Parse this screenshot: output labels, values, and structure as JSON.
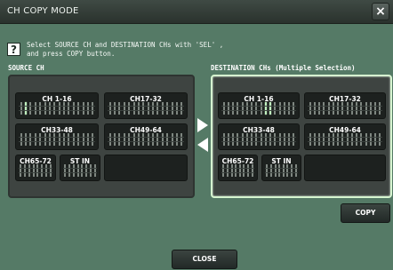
{
  "window": {
    "title": "CH COPY MODE",
    "close_glyph": "×"
  },
  "help": {
    "glyph": "?"
  },
  "instruction": {
    "line1": "Select SOURCE CH and DESTINATION CHs with 'SEL' ,",
    "line2": "and press COPY button."
  },
  "source": {
    "label": "SOURCE CH",
    "banks": [
      "CH 1-16",
      "CH17-32",
      "CH33-48",
      "CH49-64",
      "CH65-72",
      "ST IN"
    ]
  },
  "destination": {
    "label": "DESTINATION CHs (Multiple Selection)",
    "banks": [
      "CH 1-16",
      "CH17-32",
      "CH33-48",
      "CH49-64",
      "CH65-72",
      "ST IN"
    ]
  },
  "buttons": {
    "copy": "COPY",
    "close": "CLOSE"
  },
  "icons": {
    "close": "close-icon",
    "help": "help-icon",
    "to_destination": "arrow-right-icon",
    "to_source": "arrow-left-icon"
  },
  "colors": {
    "accent": "#d6f5d0",
    "background": "#557a66",
    "panel": "#3e4441"
  }
}
